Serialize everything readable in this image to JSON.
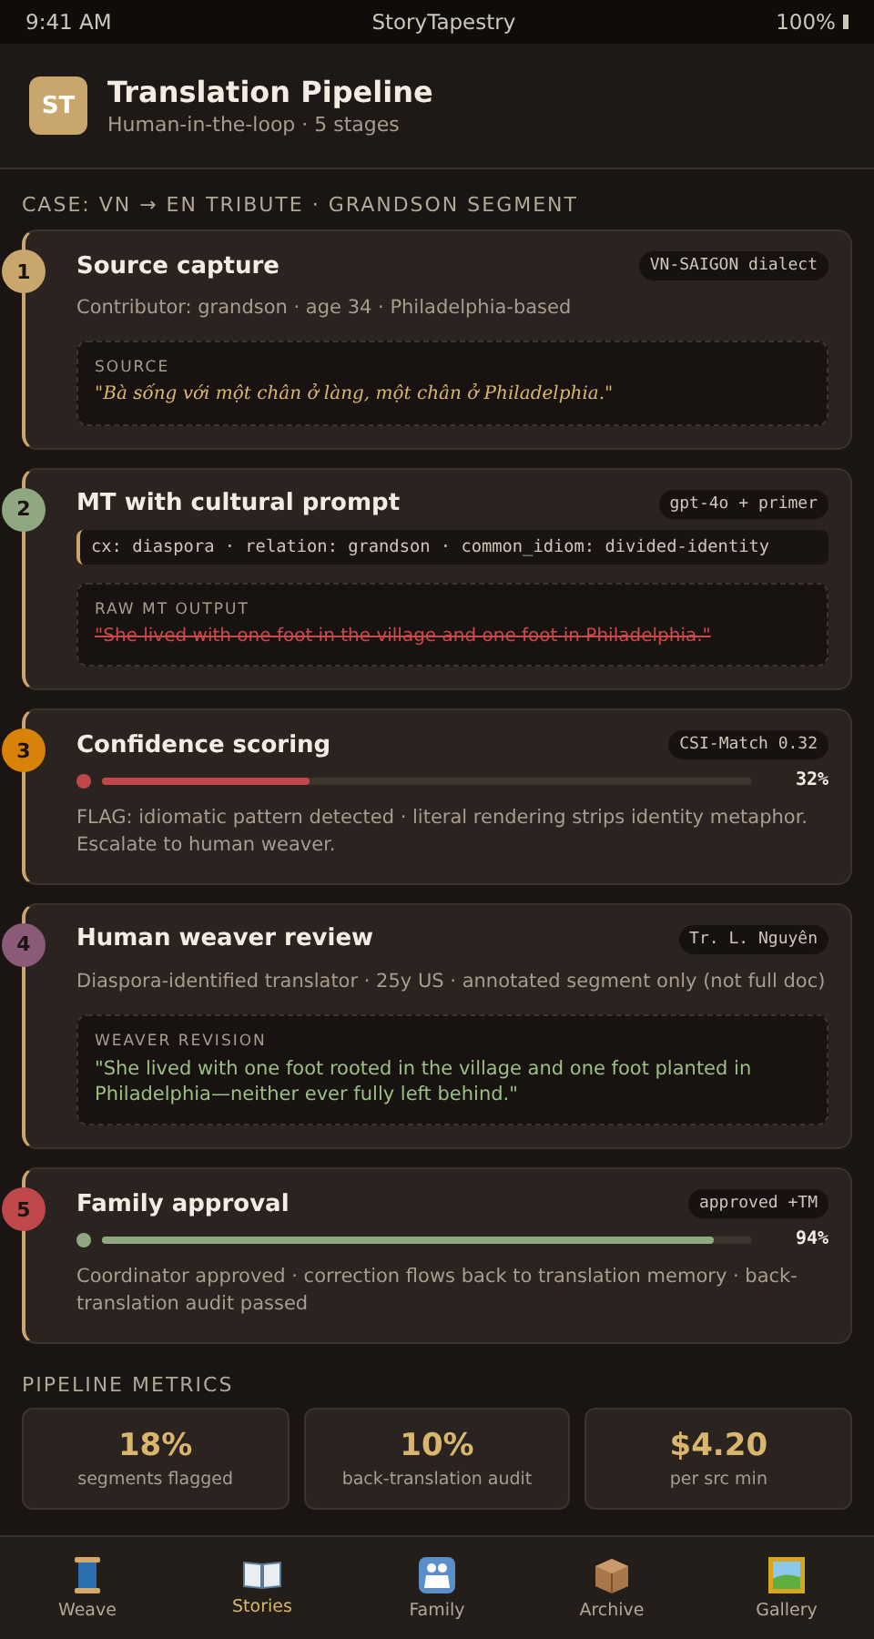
{
  "status_bar": {
    "time": "9:41 AM",
    "app": "StoryTapestry",
    "battery": "100%"
  },
  "header": {
    "logo": "ST",
    "title": "Translation Pipeline",
    "subtitle": "Human-in-the-loop · 5 stages"
  },
  "case_label": "CASE: VN → EN TRIBUTE · GRANDSON SEGMENT",
  "stages": [
    {
      "number": "1",
      "color": "#c9a66b",
      "title": "Source capture",
      "tag": "VN-SAIGON dialect",
      "subtitle": "Contributor: grandson · age 34 · Philadelphia-based",
      "quote": {
        "kind": "source",
        "label": "SOURCE",
        "text": "\"Bà sống với một chân ở làng, một chân ở Philadelphia.\""
      }
    },
    {
      "number": "2",
      "color": "#8fa882",
      "title": "MT with cultural prompt",
      "tag": "gpt-4o + primer",
      "prompt": "cx: diaspora · relation: grandson · common_idiom: divided-identity",
      "quote": {
        "kind": "struck",
        "label": "RAW MT OUTPUT",
        "text": "\"She lived with one foot in the village and one foot in Philadelphia.\""
      }
    },
    {
      "number": "3",
      "color": "#d9820a",
      "title": "Confidence scoring",
      "tag": "CSI-Match 0.32",
      "meter": {
        "level": 0.32,
        "reading": "32%",
        "color": "#c0484a"
      },
      "note": "FLAG: idiomatic pattern detected · literal rendering strips identity metaphor. Escalate to human weaver."
    },
    {
      "number": "4",
      "color": "#8a5a78",
      "title": "Human weaver review",
      "tag": "Tr. L. Nguyên",
      "subtitle": "Diaspora-identified translator · 25y US · annotated segment only (not full doc)",
      "quote": {
        "kind": "revised",
        "label": "WEAVER REVISION",
        "text": "\"She lived with one foot rooted in the village and one foot planted in Philadelphia—neither ever fully left behind.\""
      }
    },
    {
      "number": "5",
      "color": "#c0484a",
      "title": "Family approval",
      "tag": "approved +TM",
      "meter": {
        "level": 0.94,
        "reading": "94%",
        "color": "#8fa882"
      },
      "note": "Coordinator approved · correction flows back to translation memory · back-translation audit passed"
    }
  ],
  "metrics_label": "PIPELINE METRICS",
  "metrics": [
    {
      "value": "18%",
      "label": "segments flagged"
    },
    {
      "value": "10%",
      "label": "back-translation audit"
    },
    {
      "value": "$4.20",
      "label": "per src min"
    }
  ],
  "tabs": [
    {
      "label": "Weave",
      "selected": false
    },
    {
      "label": "Stories",
      "selected": true
    },
    {
      "label": "Family",
      "selected": false
    },
    {
      "label": "Archive",
      "selected": false
    },
    {
      "label": "Gallery",
      "selected": false
    }
  ]
}
